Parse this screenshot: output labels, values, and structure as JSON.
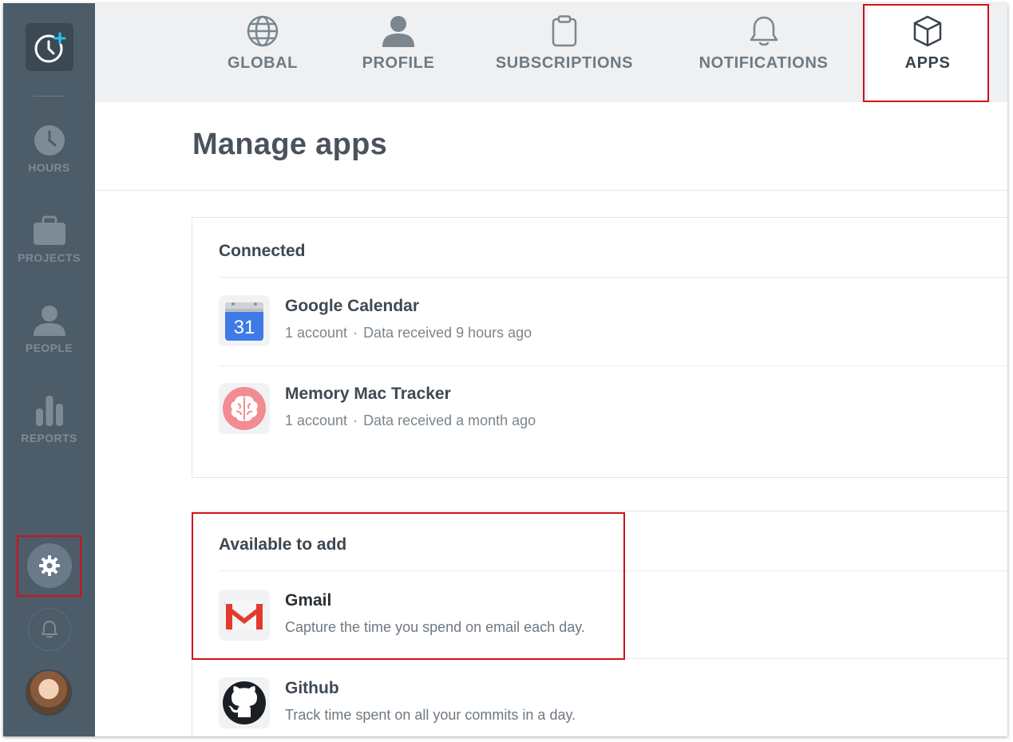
{
  "sidebar": {
    "items": [
      {
        "label": "HOURS",
        "icon": "clock-icon"
      },
      {
        "label": "PROJECTS",
        "icon": "briefcase-icon"
      },
      {
        "label": "PEOPLE",
        "icon": "person-icon"
      },
      {
        "label": "REPORTS",
        "icon": "bar-chart-icon"
      }
    ]
  },
  "tabs": [
    {
      "label": "GLOBAL",
      "icon": "globe-icon"
    },
    {
      "label": "PROFILE",
      "icon": "person-icon"
    },
    {
      "label": "SUBSCRIPTIONS",
      "icon": "clipboard-icon"
    },
    {
      "label": "NOTIFICATIONS",
      "icon": "bell-icon"
    },
    {
      "label": "APPS",
      "icon": "cube-icon",
      "active": true
    }
  ],
  "page": {
    "title": "Manage apps"
  },
  "connected": {
    "heading": "Connected",
    "apps": [
      {
        "name": "Google Calendar",
        "accounts": "1 account",
        "separator": "·",
        "received": "Data received 9 hours ago",
        "icon_text": "31"
      },
      {
        "name": "Memory Mac Tracker",
        "accounts": "1 account",
        "separator": "·",
        "received": "Data received a month ago"
      }
    ]
  },
  "available": {
    "heading": "Available to add",
    "apps": [
      {
        "name": "Gmail",
        "description": "Capture the time you spend on email each day."
      },
      {
        "name": "Github",
        "description": "Track time spent on all your commits in a day."
      }
    ]
  },
  "colors": {
    "sidebar": "#4c5c69",
    "highlight": "#d0101a",
    "logo_accent": "#27c4f0"
  }
}
